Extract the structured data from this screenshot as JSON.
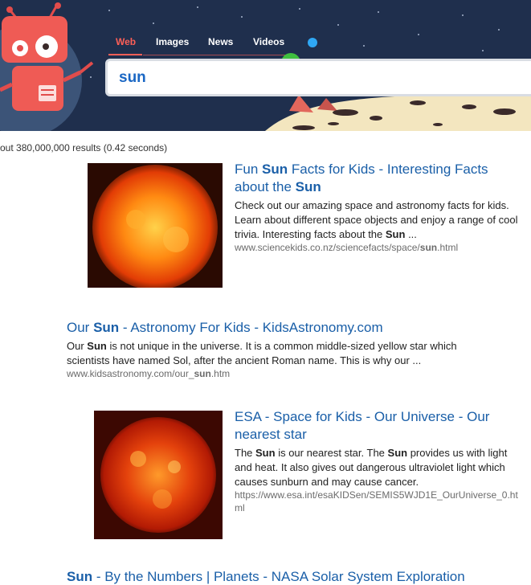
{
  "header": {
    "tabs": [
      {
        "label": "Web",
        "active": true
      },
      {
        "label": "Images",
        "active": false
      },
      {
        "label": "News",
        "active": false
      },
      {
        "label": "Videos",
        "active": false
      }
    ],
    "logo_icon": "robot-mascot-icon",
    "search": {
      "value": "sun"
    }
  },
  "stats": "out 380,000,000 results (0.42 seconds)",
  "results": [
    {
      "title_parts": [
        "Fun ",
        "Sun",
        " Facts for Kids - Interesting Facts about the ",
        "Sun"
      ],
      "snippet_parts": [
        "Check out our amazing space and astronomy facts for kids. Learn about different space objects and enjoy a range of cool trivia. Interesting facts about the ",
        "Sun",
        " ..."
      ],
      "url_parts": [
        "www.sciencekids.co.nz/sciencefacts/space/",
        "sun",
        ".html"
      ],
      "thumbnail": "sun-photo-orange"
    },
    {
      "title_parts": [
        "Our ",
        "Sun",
        " - Astronomy For Kids - KidsAstronomy.com"
      ],
      "snippet_parts": [
        "Our ",
        "Sun",
        " is not unique in the universe. It is a common middle-sized yellow star which scientists have named Sol, after the ancient Roman name. This is why our  ..."
      ],
      "url_parts": [
        "www.kidsastronomy.com/our_",
        "sun",
        ".htm"
      ]
    },
    {
      "title_parts": [
        "ESA - Space for Kids - Our Universe - Our nearest star"
      ],
      "snippet_parts": [
        "The ",
        "Sun",
        " is our nearest star. The ",
        "Sun",
        " provides us with light and heat. It also gives out dangerous ultraviolet light which causes sunburn and may cause cancer."
      ],
      "url_parts": [
        "https://www.esa.int/esaKIDSen/SEMIS5WJD1E_OurUniverse_0.html"
      ],
      "thumbnail": "sun-photo-red"
    },
    {
      "title_parts": [
        "Sun",
        " - By the Numbers | Planets - NASA Solar System Exploration"
      ]
    }
  ],
  "colors": {
    "header_bg": "#1f2f4d",
    "accent": "#ff5f57",
    "link": "#1a5fa8",
    "url": "#6b6b6b"
  }
}
